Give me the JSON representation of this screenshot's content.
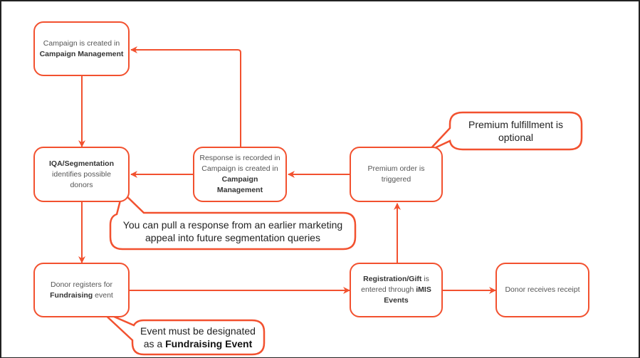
{
  "colors": {
    "accent": "#f2512f"
  },
  "nodes": {
    "campaign": {
      "pre": "Campaign is created in",
      "bold": "Campaign Management"
    },
    "iqa": {
      "bold": "IQA/Segmentation",
      "post": "identifies possible donors"
    },
    "response": {
      "pre": "Response is recorded in Campaign is created in",
      "bold": "Campaign Management"
    },
    "premium": {
      "text": "Premium order is triggered"
    },
    "register": {
      "pre": "Donor registers for",
      "bold": "Fundraising",
      "post": "event"
    },
    "gift": {
      "bold": "Registration/Gift",
      "mid": "is entered through",
      "bold2": "iMIS Events"
    },
    "receipt": {
      "text": "Donor receives receipt"
    }
  },
  "callouts": {
    "premium": {
      "text": "Premium fulfillment is optional"
    },
    "segmentation": {
      "text": "You can pull a response from an earlier marketing appeal into future segmentation queries"
    },
    "event": {
      "pre": "Event must be designated as a",
      "bold": "Fundraising Event"
    }
  }
}
